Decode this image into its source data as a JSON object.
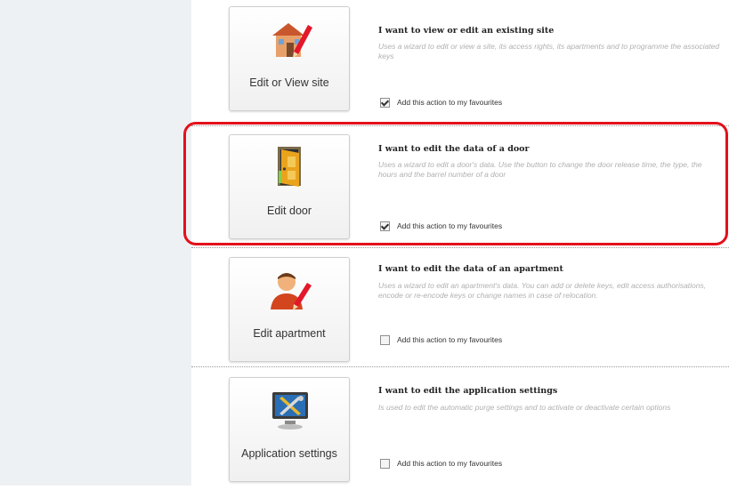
{
  "actions": [
    {
      "button_label": "Edit or View site",
      "title": "I want to view or edit an existing site",
      "description": "Uses a wizard to edit or view a site, its access rights, its apartments and to programme the associated keys",
      "favourite_label": "Add this action to my favourites",
      "favourite_checked": true,
      "icon": "site-house-pencil-icon"
    },
    {
      "button_label": "Edit door",
      "title": "I want to edit the data of a door",
      "description": "Uses a wizard to edit a door's data. Use the button to change the door release time, the type, the hours and the barrel number of a door",
      "favourite_label": "Add this action to my favourites",
      "favourite_checked": true,
      "icon": "door-icon"
    },
    {
      "button_label": "Edit apartment",
      "title": "I want to edit the data of an apartment",
      "description": "Uses a wizard to edit an apartment's data. You can add or delete keys, edit access authorisations, encode or re-encode keys or change names in case of relocation.",
      "favourite_label": "Add this action to my favourites",
      "favourite_checked": false,
      "icon": "user-pencil-icon"
    },
    {
      "button_label": "Application settings",
      "title": "I want to edit the application settings",
      "description": "Is used to edit the automatic purge settings and to activate or deactivate certain options",
      "favourite_label": "Add this action to my favourites",
      "favourite_checked": false,
      "icon": "monitor-tools-icon"
    }
  ],
  "colors": {
    "highlight": "#e3101b",
    "sidebar": "#eef1f3"
  }
}
